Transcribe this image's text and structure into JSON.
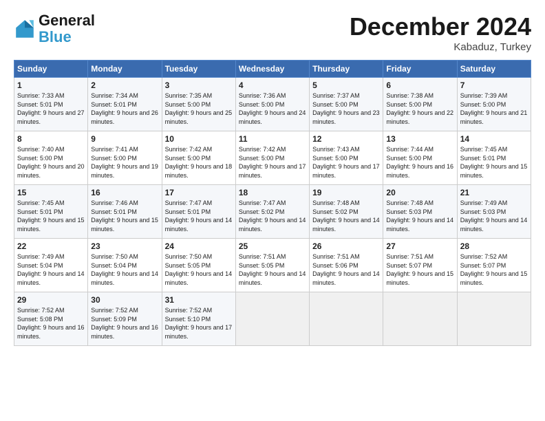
{
  "logo": {
    "line1": "General",
    "line2": "Blue"
  },
  "title": "December 2024",
  "subtitle": "Kabaduz, Turkey",
  "header_days": [
    "Sunday",
    "Monday",
    "Tuesday",
    "Wednesday",
    "Thursday",
    "Friday",
    "Saturday"
  ],
  "weeks": [
    [
      {
        "day": "1",
        "rise": "7:33 AM",
        "set": "5:01 PM",
        "daylight": "9 hours and 27 minutes."
      },
      {
        "day": "2",
        "rise": "7:34 AM",
        "set": "5:01 PM",
        "daylight": "9 hours and 26 minutes."
      },
      {
        "day": "3",
        "rise": "7:35 AM",
        "set": "5:00 PM",
        "daylight": "9 hours and 25 minutes."
      },
      {
        "day": "4",
        "rise": "7:36 AM",
        "set": "5:00 PM",
        "daylight": "9 hours and 24 minutes."
      },
      {
        "day": "5",
        "rise": "7:37 AM",
        "set": "5:00 PM",
        "daylight": "9 hours and 23 minutes."
      },
      {
        "day": "6",
        "rise": "7:38 AM",
        "set": "5:00 PM",
        "daylight": "9 hours and 22 minutes."
      },
      {
        "day": "7",
        "rise": "7:39 AM",
        "set": "5:00 PM",
        "daylight": "9 hours and 21 minutes."
      }
    ],
    [
      {
        "day": "8",
        "rise": "7:40 AM",
        "set": "5:00 PM",
        "daylight": "9 hours and 20 minutes."
      },
      {
        "day": "9",
        "rise": "7:41 AM",
        "set": "5:00 PM",
        "daylight": "9 hours and 19 minutes."
      },
      {
        "day": "10",
        "rise": "7:42 AM",
        "set": "5:00 PM",
        "daylight": "9 hours and 18 minutes."
      },
      {
        "day": "11",
        "rise": "7:42 AM",
        "set": "5:00 PM",
        "daylight": "9 hours and 17 minutes."
      },
      {
        "day": "12",
        "rise": "7:43 AM",
        "set": "5:00 PM",
        "daylight": "9 hours and 17 minutes."
      },
      {
        "day": "13",
        "rise": "7:44 AM",
        "set": "5:00 PM",
        "daylight": "9 hours and 16 minutes."
      },
      {
        "day": "14",
        "rise": "7:45 AM",
        "set": "5:01 PM",
        "daylight": "9 hours and 15 minutes."
      }
    ],
    [
      {
        "day": "15",
        "rise": "7:45 AM",
        "set": "5:01 PM",
        "daylight": "9 hours and 15 minutes."
      },
      {
        "day": "16",
        "rise": "7:46 AM",
        "set": "5:01 PM",
        "daylight": "9 hours and 15 minutes."
      },
      {
        "day": "17",
        "rise": "7:47 AM",
        "set": "5:01 PM",
        "daylight": "9 hours and 14 minutes."
      },
      {
        "day": "18",
        "rise": "7:47 AM",
        "set": "5:02 PM",
        "daylight": "9 hours and 14 minutes."
      },
      {
        "day": "19",
        "rise": "7:48 AM",
        "set": "5:02 PM",
        "daylight": "9 hours and 14 minutes."
      },
      {
        "day": "20",
        "rise": "7:48 AM",
        "set": "5:03 PM",
        "daylight": "9 hours and 14 minutes."
      },
      {
        "day": "21",
        "rise": "7:49 AM",
        "set": "5:03 PM",
        "daylight": "9 hours and 14 minutes."
      }
    ],
    [
      {
        "day": "22",
        "rise": "7:49 AM",
        "set": "5:04 PM",
        "daylight": "9 hours and 14 minutes."
      },
      {
        "day": "23",
        "rise": "7:50 AM",
        "set": "5:04 PM",
        "daylight": "9 hours and 14 minutes."
      },
      {
        "day": "24",
        "rise": "7:50 AM",
        "set": "5:05 PM",
        "daylight": "9 hours and 14 minutes."
      },
      {
        "day": "25",
        "rise": "7:51 AM",
        "set": "5:05 PM",
        "daylight": "9 hours and 14 minutes."
      },
      {
        "day": "26",
        "rise": "7:51 AM",
        "set": "5:06 PM",
        "daylight": "9 hours and 14 minutes."
      },
      {
        "day": "27",
        "rise": "7:51 AM",
        "set": "5:07 PM",
        "daylight": "9 hours and 15 minutes."
      },
      {
        "day": "28",
        "rise": "7:52 AM",
        "set": "5:07 PM",
        "daylight": "9 hours and 15 minutes."
      }
    ],
    [
      {
        "day": "29",
        "rise": "7:52 AM",
        "set": "5:08 PM",
        "daylight": "9 hours and 16 minutes."
      },
      {
        "day": "30",
        "rise": "7:52 AM",
        "set": "5:09 PM",
        "daylight": "9 hours and 16 minutes."
      },
      {
        "day": "31",
        "rise": "7:52 AM",
        "set": "5:10 PM",
        "daylight": "9 hours and 17 minutes."
      },
      null,
      null,
      null,
      null
    ]
  ],
  "labels": {
    "sunrise": "Sunrise:",
    "sunset": "Sunset:",
    "daylight": "Daylight:"
  }
}
